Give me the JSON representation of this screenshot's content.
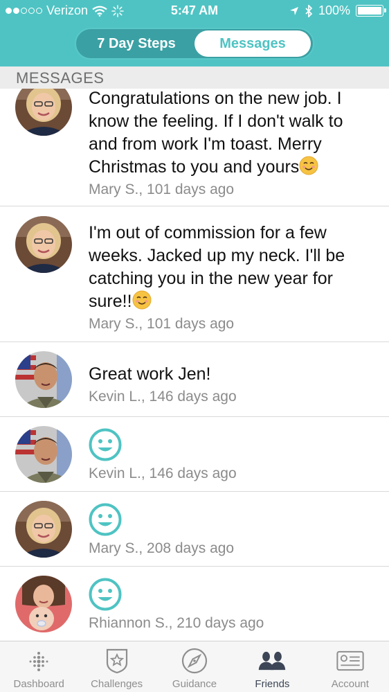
{
  "status_bar": {
    "carrier": "Verizon",
    "time": "5:47 AM",
    "battery": "100%"
  },
  "segmented": {
    "tab1": "7 Day Steps",
    "tab2": "Messages",
    "active": "Messages"
  },
  "section_title": "MESSAGES",
  "messages": [
    {
      "text": "Congratulations on the new job.  I know the feeling.  If I don't walk to and from work I'm toast.  Merry Christmas to you and yours",
      "trailing_emoji": "smiling-face-emoji",
      "meta": "Mary S., 101 days ago",
      "avatar": "mary"
    },
    {
      "text": "I'm out of commission for a few weeks.  Jacked up my neck.  I'll be catching you in the new year for sure!!",
      "trailing_emoji": "smiling-face-emoji",
      "meta": "Mary S., 101 days ago",
      "avatar": "mary"
    },
    {
      "text": "Great work Jen!",
      "meta": "Kevin L., 146 days ago",
      "avatar": "kevin"
    },
    {
      "smiley": "smiley-face-icon",
      "meta": "Kevin L., 146 days ago",
      "avatar": "kevin"
    },
    {
      "smiley": "smiley-face-icon",
      "meta": "Mary S., 208 days ago",
      "avatar": "mary"
    },
    {
      "smiley": "smiley-face-icon",
      "meta": "Rhiannon S., 210 days ago",
      "avatar": "rhiannon"
    }
  ],
  "tabbar": {
    "dashboard": "Dashboard",
    "challenges": "Challenges",
    "guidance": "Guidance",
    "friends": "Friends",
    "account": "Account",
    "active": "Friends"
  },
  "colors": {
    "accent": "#4fc3c3",
    "segment_bg": "#3ba0a3",
    "meta_text": "#8b8b8b",
    "tab_inactive": "#8e8e8e",
    "tab_active": "#3d4656"
  }
}
